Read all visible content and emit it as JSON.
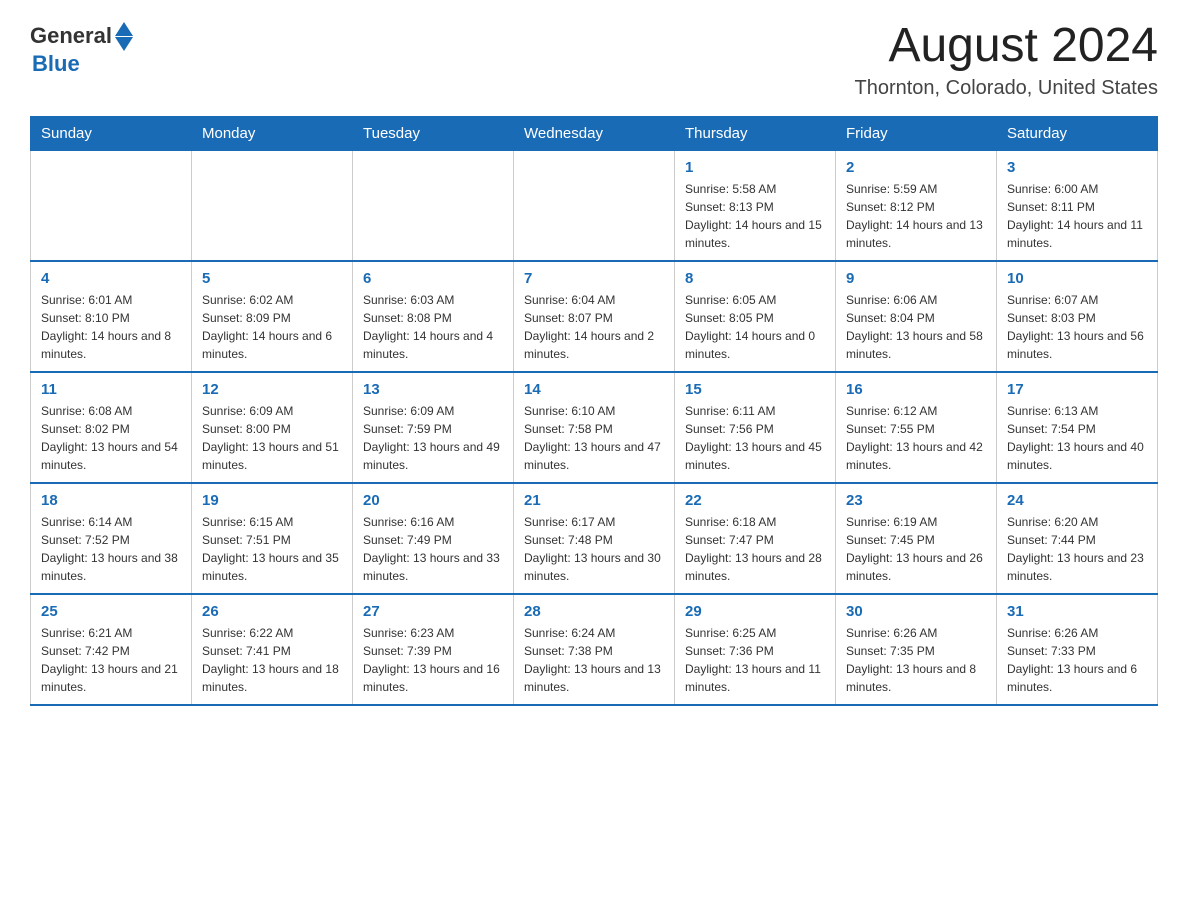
{
  "logo": {
    "text_general": "General",
    "text_blue": "Blue"
  },
  "header": {
    "month_title": "August 2024",
    "location": "Thornton, Colorado, United States"
  },
  "weekdays": [
    "Sunday",
    "Monday",
    "Tuesday",
    "Wednesday",
    "Thursday",
    "Friday",
    "Saturday"
  ],
  "weeks": [
    [
      {
        "day": "",
        "sunrise": "",
        "sunset": "",
        "daylight": ""
      },
      {
        "day": "",
        "sunrise": "",
        "sunset": "",
        "daylight": ""
      },
      {
        "day": "",
        "sunrise": "",
        "sunset": "",
        "daylight": ""
      },
      {
        "day": "",
        "sunrise": "",
        "sunset": "",
        "daylight": ""
      },
      {
        "day": "1",
        "sunrise": "Sunrise: 5:58 AM",
        "sunset": "Sunset: 8:13 PM",
        "daylight": "Daylight: 14 hours and 15 minutes."
      },
      {
        "day": "2",
        "sunrise": "Sunrise: 5:59 AM",
        "sunset": "Sunset: 8:12 PM",
        "daylight": "Daylight: 14 hours and 13 minutes."
      },
      {
        "day": "3",
        "sunrise": "Sunrise: 6:00 AM",
        "sunset": "Sunset: 8:11 PM",
        "daylight": "Daylight: 14 hours and 11 minutes."
      }
    ],
    [
      {
        "day": "4",
        "sunrise": "Sunrise: 6:01 AM",
        "sunset": "Sunset: 8:10 PM",
        "daylight": "Daylight: 14 hours and 8 minutes."
      },
      {
        "day": "5",
        "sunrise": "Sunrise: 6:02 AM",
        "sunset": "Sunset: 8:09 PM",
        "daylight": "Daylight: 14 hours and 6 minutes."
      },
      {
        "day": "6",
        "sunrise": "Sunrise: 6:03 AM",
        "sunset": "Sunset: 8:08 PM",
        "daylight": "Daylight: 14 hours and 4 minutes."
      },
      {
        "day": "7",
        "sunrise": "Sunrise: 6:04 AM",
        "sunset": "Sunset: 8:07 PM",
        "daylight": "Daylight: 14 hours and 2 minutes."
      },
      {
        "day": "8",
        "sunrise": "Sunrise: 6:05 AM",
        "sunset": "Sunset: 8:05 PM",
        "daylight": "Daylight: 14 hours and 0 minutes."
      },
      {
        "day": "9",
        "sunrise": "Sunrise: 6:06 AM",
        "sunset": "Sunset: 8:04 PM",
        "daylight": "Daylight: 13 hours and 58 minutes."
      },
      {
        "day": "10",
        "sunrise": "Sunrise: 6:07 AM",
        "sunset": "Sunset: 8:03 PM",
        "daylight": "Daylight: 13 hours and 56 minutes."
      }
    ],
    [
      {
        "day": "11",
        "sunrise": "Sunrise: 6:08 AM",
        "sunset": "Sunset: 8:02 PM",
        "daylight": "Daylight: 13 hours and 54 minutes."
      },
      {
        "day": "12",
        "sunrise": "Sunrise: 6:09 AM",
        "sunset": "Sunset: 8:00 PM",
        "daylight": "Daylight: 13 hours and 51 minutes."
      },
      {
        "day": "13",
        "sunrise": "Sunrise: 6:09 AM",
        "sunset": "Sunset: 7:59 PM",
        "daylight": "Daylight: 13 hours and 49 minutes."
      },
      {
        "day": "14",
        "sunrise": "Sunrise: 6:10 AM",
        "sunset": "Sunset: 7:58 PM",
        "daylight": "Daylight: 13 hours and 47 minutes."
      },
      {
        "day": "15",
        "sunrise": "Sunrise: 6:11 AM",
        "sunset": "Sunset: 7:56 PM",
        "daylight": "Daylight: 13 hours and 45 minutes."
      },
      {
        "day": "16",
        "sunrise": "Sunrise: 6:12 AM",
        "sunset": "Sunset: 7:55 PM",
        "daylight": "Daylight: 13 hours and 42 minutes."
      },
      {
        "day": "17",
        "sunrise": "Sunrise: 6:13 AM",
        "sunset": "Sunset: 7:54 PM",
        "daylight": "Daylight: 13 hours and 40 minutes."
      }
    ],
    [
      {
        "day": "18",
        "sunrise": "Sunrise: 6:14 AM",
        "sunset": "Sunset: 7:52 PM",
        "daylight": "Daylight: 13 hours and 38 minutes."
      },
      {
        "day": "19",
        "sunrise": "Sunrise: 6:15 AM",
        "sunset": "Sunset: 7:51 PM",
        "daylight": "Daylight: 13 hours and 35 minutes."
      },
      {
        "day": "20",
        "sunrise": "Sunrise: 6:16 AM",
        "sunset": "Sunset: 7:49 PM",
        "daylight": "Daylight: 13 hours and 33 minutes."
      },
      {
        "day": "21",
        "sunrise": "Sunrise: 6:17 AM",
        "sunset": "Sunset: 7:48 PM",
        "daylight": "Daylight: 13 hours and 30 minutes."
      },
      {
        "day": "22",
        "sunrise": "Sunrise: 6:18 AM",
        "sunset": "Sunset: 7:47 PM",
        "daylight": "Daylight: 13 hours and 28 minutes."
      },
      {
        "day": "23",
        "sunrise": "Sunrise: 6:19 AM",
        "sunset": "Sunset: 7:45 PM",
        "daylight": "Daylight: 13 hours and 26 minutes."
      },
      {
        "day": "24",
        "sunrise": "Sunrise: 6:20 AM",
        "sunset": "Sunset: 7:44 PM",
        "daylight": "Daylight: 13 hours and 23 minutes."
      }
    ],
    [
      {
        "day": "25",
        "sunrise": "Sunrise: 6:21 AM",
        "sunset": "Sunset: 7:42 PM",
        "daylight": "Daylight: 13 hours and 21 minutes."
      },
      {
        "day": "26",
        "sunrise": "Sunrise: 6:22 AM",
        "sunset": "Sunset: 7:41 PM",
        "daylight": "Daylight: 13 hours and 18 minutes."
      },
      {
        "day": "27",
        "sunrise": "Sunrise: 6:23 AM",
        "sunset": "Sunset: 7:39 PM",
        "daylight": "Daylight: 13 hours and 16 minutes."
      },
      {
        "day": "28",
        "sunrise": "Sunrise: 6:24 AM",
        "sunset": "Sunset: 7:38 PM",
        "daylight": "Daylight: 13 hours and 13 minutes."
      },
      {
        "day": "29",
        "sunrise": "Sunrise: 6:25 AM",
        "sunset": "Sunset: 7:36 PM",
        "daylight": "Daylight: 13 hours and 11 minutes."
      },
      {
        "day": "30",
        "sunrise": "Sunrise: 6:26 AM",
        "sunset": "Sunset: 7:35 PM",
        "daylight": "Daylight: 13 hours and 8 minutes."
      },
      {
        "day": "31",
        "sunrise": "Sunrise: 6:26 AM",
        "sunset": "Sunset: 7:33 PM",
        "daylight": "Daylight: 13 hours and 6 minutes."
      }
    ]
  ]
}
